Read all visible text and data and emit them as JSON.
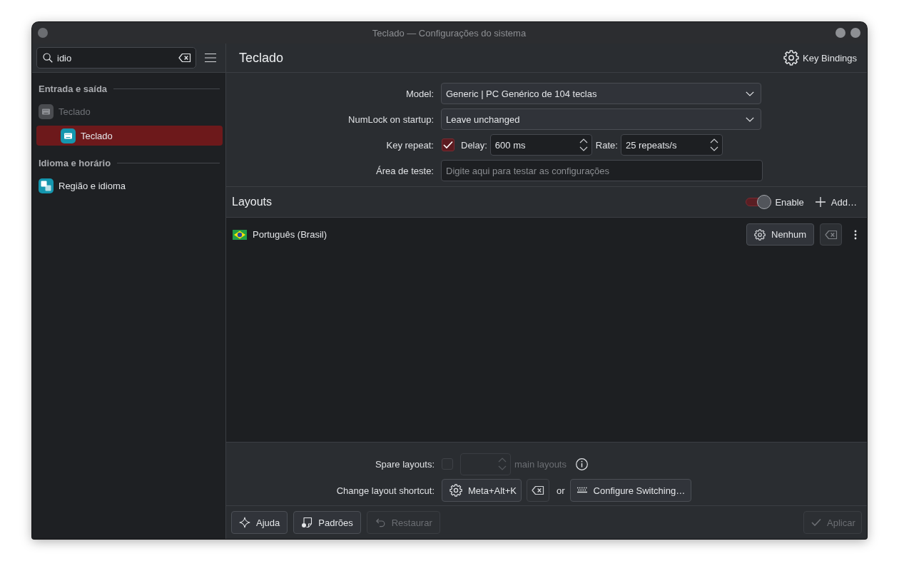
{
  "window": {
    "title": "Teclado — Configurações do sistema"
  },
  "search": {
    "value": "idio"
  },
  "sidebar": {
    "sections": [
      {
        "title": "Entrada e saída",
        "items": [
          {
            "label": "Teclado",
            "kind": "keyboard",
            "disabled": true,
            "selected": false,
            "children": [
              {
                "label": "Teclado",
                "kind": "keyboard",
                "disabled": false,
                "selected": true
              }
            ]
          }
        ]
      },
      {
        "title": "Idioma e horário",
        "items": [
          {
            "label": "Região e idioma",
            "kind": "language",
            "disabled": false,
            "selected": false
          }
        ]
      }
    ]
  },
  "page": {
    "title": "Teclado",
    "header_button": "Key Bindings"
  },
  "form": {
    "model": {
      "label": "Model:",
      "value": "Generic | PC Genérico de 104 teclas"
    },
    "numlock": {
      "label": "NumLock on startup:",
      "value": "Leave unchanged"
    },
    "key_repeat": {
      "label": "Key repeat:",
      "checked": true,
      "delay_label": "Delay:",
      "delay": "600 ms",
      "rate_label": "Rate:",
      "rate": "25 repeats/s"
    },
    "test_area": {
      "label": "Área de teste:",
      "placeholder": "Digite aqui para testar as configurações"
    }
  },
  "layouts": {
    "title": "Layouts",
    "enable": {
      "label": "Enable",
      "on": true
    },
    "add_button": "Add…",
    "items": [
      {
        "name": "Português (Brasil)",
        "variant_button": "Nenhum"
      }
    ]
  },
  "spare_layouts": {
    "label": "Spare layouts:",
    "checked": false,
    "disabled": true,
    "suffix": "main layouts"
  },
  "shortcut": {
    "label": "Change layout shortcut:",
    "value": "Meta+Alt+K",
    "or": "or",
    "configure_button": "Configure Switching…"
  },
  "footer": {
    "buttons": [
      {
        "label": "Ajuda",
        "kind": "help",
        "disabled": false
      },
      {
        "label": "Padrões",
        "kind": "defaults",
        "disabled": false
      },
      {
        "label": "Restaurar",
        "kind": "reset",
        "disabled": true
      }
    ],
    "apply": {
      "label": "Aplicar",
      "disabled": true
    }
  }
}
